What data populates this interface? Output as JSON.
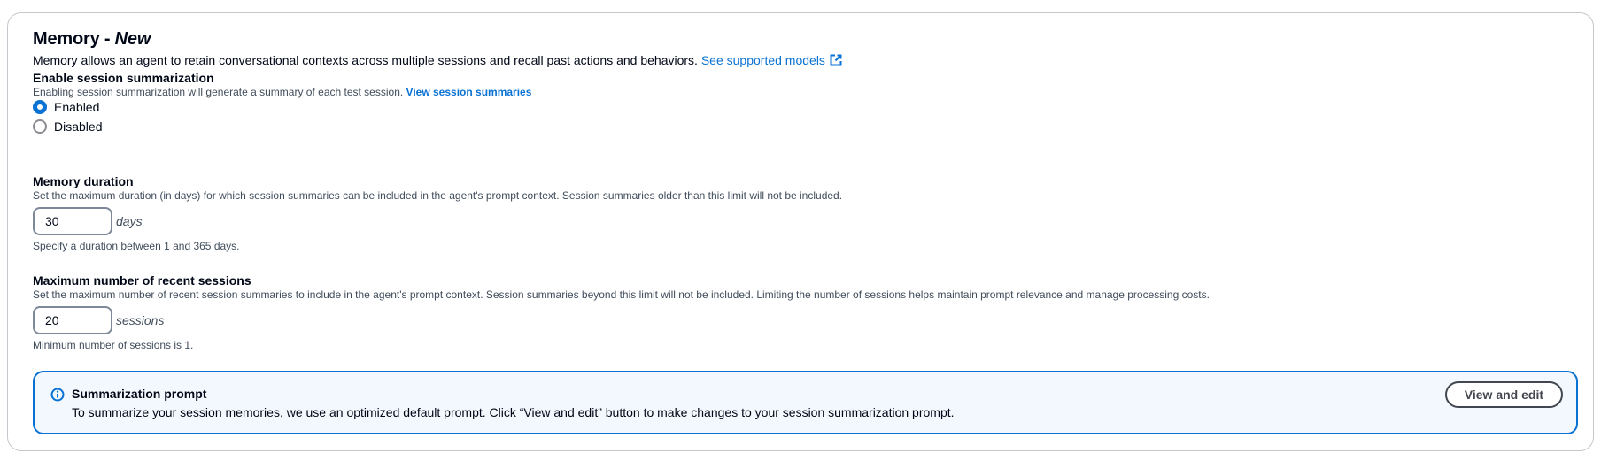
{
  "memory": {
    "title_main": "Memory - ",
    "title_badge": "New",
    "description": "Memory allows an agent to retain conversational contexts across multiple sessions and recall past actions and behaviors.",
    "supported_models_link": "See supported models"
  },
  "session_summarization": {
    "label": "Enable session summarization",
    "hint": "Enabling session summarization will generate a summary of each test session.",
    "view_link": "View session summaries",
    "options": [
      {
        "label": "Enabled",
        "selected": true
      },
      {
        "label": "Disabled",
        "selected": false
      }
    ]
  },
  "memory_duration": {
    "label": "Memory duration",
    "hint": "Set the maximum duration (in days) for which session summaries can be included in the agent's prompt context. Session summaries older than this limit will not be included.",
    "value": "30",
    "unit": "days",
    "constraint": "Specify a duration between 1 and 365 days."
  },
  "max_sessions": {
    "label": "Maximum number of recent sessions",
    "hint": "Set the maximum number of recent session summaries to include in the agent's prompt context. Session summaries beyond this limit will not be included. Limiting the number of sessions helps maintain prompt relevance and manage processing costs.",
    "value": "20",
    "unit": "sessions",
    "constraint": "Minimum number of sessions is 1."
  },
  "alert": {
    "title": "Summarization prompt",
    "text": "To summarize your session memories, we use an optimized default prompt. Click “View and edit” button to make changes to your session summarization prompt.",
    "button": "View and edit",
    "icon": "info-icon"
  },
  "colors": {
    "accent": "#0972d3",
    "alert_bg": "#f2f8fd",
    "text": "#000716",
    "secondary_text": "#414d5c"
  }
}
